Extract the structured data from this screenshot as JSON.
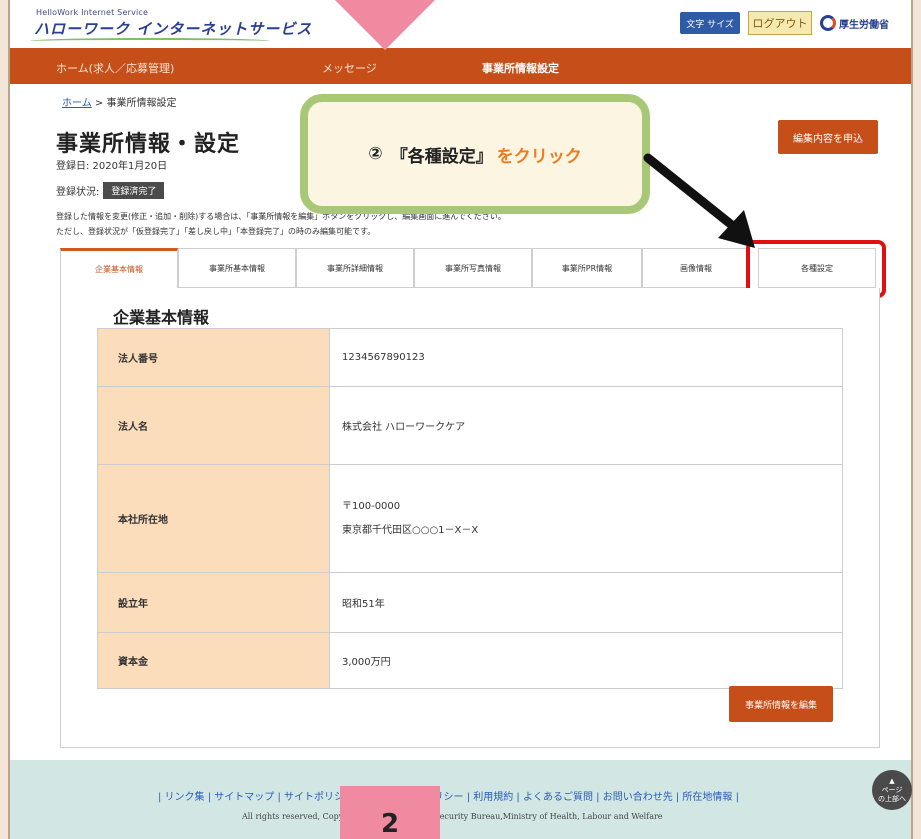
{
  "header": {
    "logo_sub": "HelloWork Internet Service",
    "logo": "ハローワーク インターネットサービス",
    "access_label": "文字 サイズ",
    "logout_label": "ログアウト",
    "ministry_label": "厚生労働省"
  },
  "nav": {
    "items": [
      "ホーム(求人／応募管理)",
      "メッセージ",
      "事業所情報設定"
    ]
  },
  "breadcrumb": {
    "home": "ホーム",
    "current": "事業所情報設定"
  },
  "page": {
    "title": "事業所情報・設定",
    "reg_date": "登録日: 2020年1月20日",
    "reg_status_label": "登録状況:",
    "reg_status_value": "登録済完了",
    "notice_line1": "登録した情報を変更(修正・追加・削除)する場合は、「事業所情報を編集」ボタンをクリックし、編集画面に進んでください。",
    "notice_line2": "ただし、登録状況が「仮登録完了」「差し戻し中」「本登録完了」の時のみ編集可能です。",
    "apply_button": "編集内容を申込"
  },
  "tabs": [
    "企業基本情報",
    "事業所基本情報",
    "事業所詳細情報",
    "事業所写真情報",
    "事業所PR情報",
    "画像情報",
    "各種設定"
  ],
  "section": {
    "title": "企業基本情報",
    "rows": [
      {
        "label": "法人番号",
        "value": "1234567890123"
      },
      {
        "label": "法人名",
        "value": "株式会社 ハローワークケア"
      },
      {
        "label": "本社所在地",
        "value_line1": "〒100-0000",
        "value_line2": "東京都千代田区○○○1－X－X"
      },
      {
        "label": "設立年",
        "value": "昭和51年"
      },
      {
        "label": "資本金",
        "value": "3,000万円"
      }
    ],
    "edit_button": "事業所情報を編集"
  },
  "footer": {
    "links": "| リンク集 | サイトマップ | サイトポリシー | プライバシーポリシー | 利用規約 | よくあるご質問 | お問い合わせ先 | 所在地情報 |",
    "copyright": "All rights reserved, Copyright (C) Employment Security Bureau,Ministry of Health, Labour and Welfare",
    "pagetop_line1": "ページ",
    "pagetop_line2": "の上部へ"
  },
  "callout": {
    "number": "②",
    "quoted": "『各種設定』",
    "accent": "をクリック"
  },
  "bottom_badge": "2",
  "colors": {
    "nav": "#c64f19",
    "label_bg": "#fbddbc",
    "footer": "#d2e7e3",
    "highlight": "#e01010",
    "callout_border": "#a8c878",
    "accent": "#ef7b1d",
    "pink": "#f08aa0"
  }
}
